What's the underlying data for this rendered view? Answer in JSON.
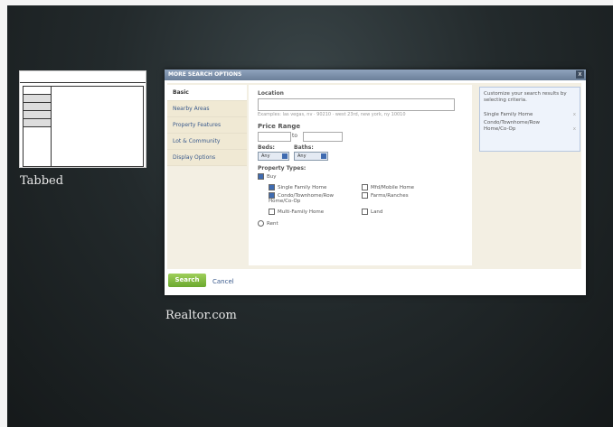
{
  "wireframe": {
    "caption": "Tabbed"
  },
  "dialog": {
    "title": "MORE SEARCH OPTIONS",
    "close": "x",
    "sidebar": {
      "items": [
        {
          "label": "Basic"
        },
        {
          "label": "Nearby Areas"
        },
        {
          "label": "Property Features"
        },
        {
          "label": "Lot & Community"
        },
        {
          "label": "Display Options"
        }
      ]
    },
    "location": {
      "label": "Location",
      "value": "",
      "hint": "Examples: las vegas, nv · 90210 · west 23rd, new york, ny 10010"
    },
    "price": {
      "label": "Price Range",
      "to": "to",
      "min": "",
      "max": ""
    },
    "beds": {
      "label": "Beds:",
      "value": "Any"
    },
    "baths": {
      "label": "Baths:",
      "value": "Any"
    },
    "types": {
      "label": "Property Types:",
      "buy": "Buy",
      "options": [
        {
          "label": "Single Family Home",
          "checked": true
        },
        {
          "label": "Mfd/Mobile Home",
          "checked": false
        },
        {
          "label": "Condo/Townhome/Row Home/Co-Op",
          "checked": true
        },
        {
          "label": "Farms/Ranches",
          "checked": false
        },
        {
          "label": "Multi-Family Home",
          "checked": false
        },
        {
          "label": "Land",
          "checked": false
        }
      ],
      "rent": "Rent"
    },
    "tip": {
      "text": "Customize your search results by selecting criteria.",
      "items": [
        {
          "label": "Single Family Home"
        },
        {
          "label": "Condo/Townhome/Row Home/Co-Op"
        }
      ],
      "remove": "x"
    },
    "search_button": "Search",
    "cancel_link": "Cancel"
  },
  "caption": "Realtor.com"
}
